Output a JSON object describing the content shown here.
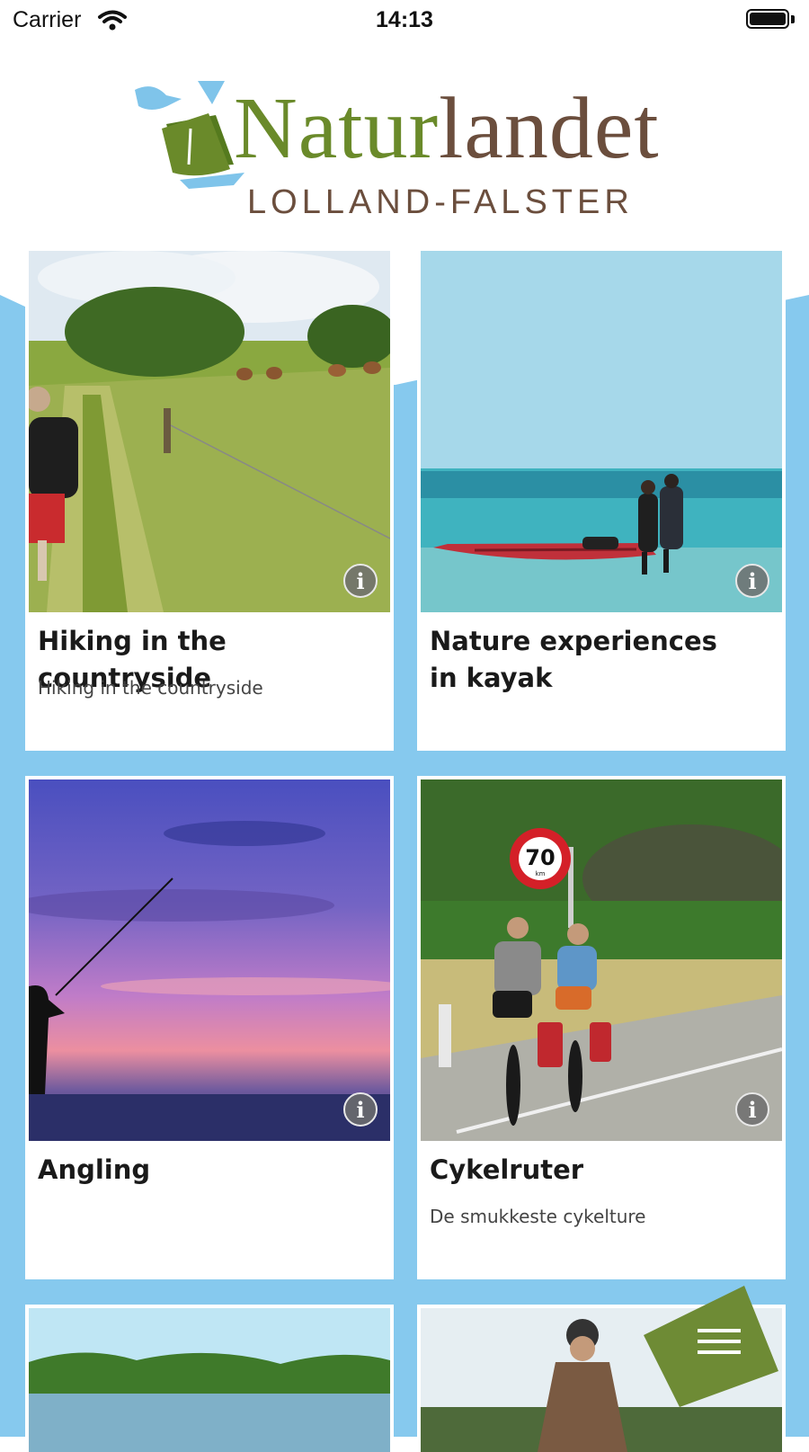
{
  "status_bar": {
    "carrier": "Carrier",
    "time": "14:13"
  },
  "header": {
    "logo_word_green": "Natur",
    "logo_word_brown": "landet",
    "logo_subtitle": "LOLLAND-FALSTER"
  },
  "colors": {
    "band": "#86c9ee",
    "logo_green": "#6a8a2a",
    "logo_brown": "#6b4e3d",
    "fab": "#6e8b35"
  },
  "cards": [
    {
      "title": "Hiking in the countryside",
      "subtitle": "Hiking in the countryside",
      "icon": "info-icon"
    },
    {
      "title": "Nature experiences in kayak",
      "subtitle": "",
      "icon": "info-icon"
    },
    {
      "title": "Angling",
      "subtitle": "",
      "icon": "info-icon"
    },
    {
      "title": "Cykelruter",
      "subtitle": "De smukkeste cykelture",
      "icon": "info-icon",
      "sign_text": "70",
      "sign_unit": "km"
    },
    {
      "title": "",
      "subtitle": ""
    },
    {
      "title": "",
      "subtitle": ""
    }
  ],
  "menu": {
    "icon": "hamburger-menu-icon"
  }
}
